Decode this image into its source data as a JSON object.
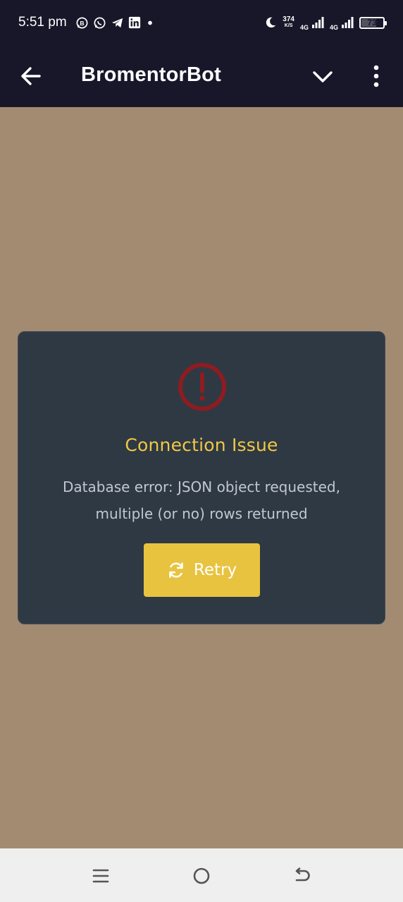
{
  "status_bar": {
    "time": "5:51 pm",
    "notification_icons": [
      "whatsapp-business-icon",
      "whatsapp-icon",
      "telegram-icon",
      "linkedin-icon",
      "dot-icon"
    ],
    "net_speed_value": "374",
    "net_speed_unit": "K/S",
    "network_1": "4G",
    "network_2": "4G",
    "battery": "73",
    "battery_level": 0.73
  },
  "app_bar": {
    "title": "BromentorBot",
    "icons": [
      "back-arrow-icon",
      "chevron-down-icon",
      "more-vert-icon"
    ]
  },
  "error_card": {
    "icon": "error-circle-icon",
    "title": "Connection Issue",
    "message_line1": "Database error: JSON object requested,",
    "message_line2": "multiple (or no) rows returned",
    "retry_label": "Retry",
    "retry_icon": "refresh-icon"
  },
  "nav_bar": {
    "icons": [
      "recents-menu-icon",
      "home-circle-icon",
      "back-nav-icon"
    ]
  },
  "colors": {
    "top_bar": "#18172a",
    "background": "#a38b72",
    "card": "#2e3944",
    "accent": "#f2c744",
    "button": "#e8c33f",
    "error": "#8e1c20"
  }
}
